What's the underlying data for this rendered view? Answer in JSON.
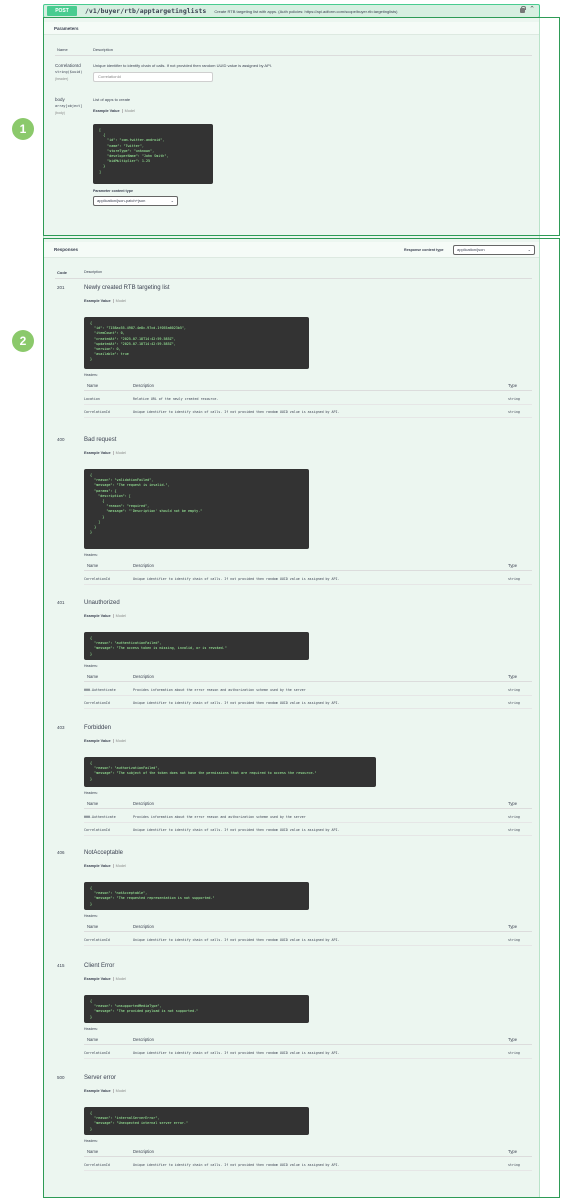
{
  "header": {
    "method": "POST",
    "path": "/v1/buyer/rtb/apptargetinglists",
    "summary": "Create RTB targeting list with apps. (Auth policies: https://api.adform.com/scope/buyer.rtb.targetinglists)"
  },
  "badges": [
    "1",
    "2"
  ],
  "parameters": {
    "title": "Parameters",
    "col_name": "Name",
    "col_desc": "Description",
    "items": [
      {
        "name": "CorrelationId",
        "type": "string($uuid)",
        "in": "(header)",
        "description": "Unique identifier to identify chain of calls. If not provided then random UUID value is assigned by API.",
        "placeholder": "CorrelationId"
      },
      {
        "name": "body",
        "type": "array[object]",
        "in": "(body)",
        "description": "List of apps to create",
        "example_tab": "Example Value",
        "model_tab": "Model",
        "example": "[\n  {\n    \"id\": \"com.twitter.android\",\n    \"name\": \"Twitter\",\n    \"storeType\": \"unknown\",\n    \"developerName\": \"John Smith\",\n    \"bidMultiplier\": 1.25\n  }\n]",
        "content_type_label": "Parameter content type",
        "content_type": "application/json-patch+json"
      }
    ]
  },
  "responses": {
    "title": "Responses",
    "content_type_label": "Response content type",
    "content_type": "application/json",
    "col_code": "Code",
    "col_desc": "Description",
    "example_tab": "Example Value",
    "model_tab": "Model",
    "headers_label": "Headers:",
    "h_name": "Name",
    "h_desc": "Description",
    "h_type": "Type",
    "items": [
      {
        "code": "201",
        "desc": "Newly created RTB targeting list",
        "example": "{\n  \"id\": \"7158ac55-4987-4e8c-97cd-1f055a6023b5\",\n  \"itemCount\": 0,\n  \"createdAt\": \"2025-07-18T14:42:59.585Z\",\n  \"updatedAt\": \"2025-07-18T14:42:59.585Z\",\n  \"version\": 0,\n  \"available\": true\n}",
        "headers": [
          {
            "name": "Location",
            "desc": "Relative URL of the newly created resource.",
            "type": "string"
          },
          {
            "name": "CorrelationId",
            "desc": "Unique identifier to identify chain of calls. If not provided then random UUID value is assigned by API.",
            "type": "string"
          }
        ]
      },
      {
        "code": "400",
        "desc": "Bad request",
        "example": "{\n  \"reason\": \"validationFailed\",\n  \"message\": \"The request is invalid.\",\n  \"params\": {\n    \"description\": [\n      {\n        \"reason\": \"required\",\n        \"message\": \"'Description' should not be empty.\"\n      }\n    ]\n  }\n}",
        "headers": [
          {
            "name": "CorrelationId",
            "desc": "Unique identifier to identify chain of calls. If not provided then random UUID value is assigned by API.",
            "type": "string"
          }
        ]
      },
      {
        "code": "401",
        "desc": "Unauthorized",
        "example": "{\n  \"reason\": \"authenticationFailed\",\n  \"message\": \"The access token is missing, invalid, or is revoked.\"\n}",
        "headers": [
          {
            "name": "WWW-Authenticate",
            "desc": "Provides information about the error reason and authorization scheme used by the server",
            "type": "string"
          },
          {
            "name": "CorrelationId",
            "desc": "Unique identifier to identify chain of calls. If not provided then random UUID value is assigned by API.",
            "type": "string"
          }
        ]
      },
      {
        "code": "403",
        "desc": "Forbidden",
        "example": "{\n  \"reason\": \"authorizationFailed\",\n  \"message\": \"The subject of the token does not have the permissions that are required to access the resource.\"\n}",
        "headers": [
          {
            "name": "WWW-Authenticate",
            "desc": "Provides information about the error reason and authorization scheme used by the server",
            "type": "string"
          },
          {
            "name": "CorrelationId",
            "desc": "Unique identifier to identify chain of calls. If not provided then random UUID value is assigned by API.",
            "type": "string"
          }
        ]
      },
      {
        "code": "406",
        "desc": "NotAcceptable",
        "example": "{\n  \"reason\": \"notAcceptable\",\n  \"message\": \"The requested representation is not supported.\"\n}",
        "headers": [
          {
            "name": "CorrelationId",
            "desc": "Unique identifier to identify chain of calls. If not provided then random UUID value is assigned by API.",
            "type": "string"
          }
        ]
      },
      {
        "code": "415",
        "desc": "Client Error",
        "example": "{\n  \"reason\": \"unsupportedMediaType\",\n  \"message\": \"The provided payload is not supported.\"\n}",
        "headers": [
          {
            "name": "CorrelationId",
            "desc": "Unique identifier to identify chain of calls. If not provided then random UUID value is assigned by API.",
            "type": "string"
          }
        ]
      },
      {
        "code": "500",
        "desc": "Server error",
        "example": "{\n  \"reason\": \"internalServerError\",\n  \"message\": \"Unexpected internal server error.\"\n}",
        "headers": [
          {
            "name": "CorrelationId",
            "desc": "Unique identifier to identify chain of calls. If not provided then random UUID value is assigned by API.",
            "type": "string"
          }
        ]
      }
    ]
  }
}
